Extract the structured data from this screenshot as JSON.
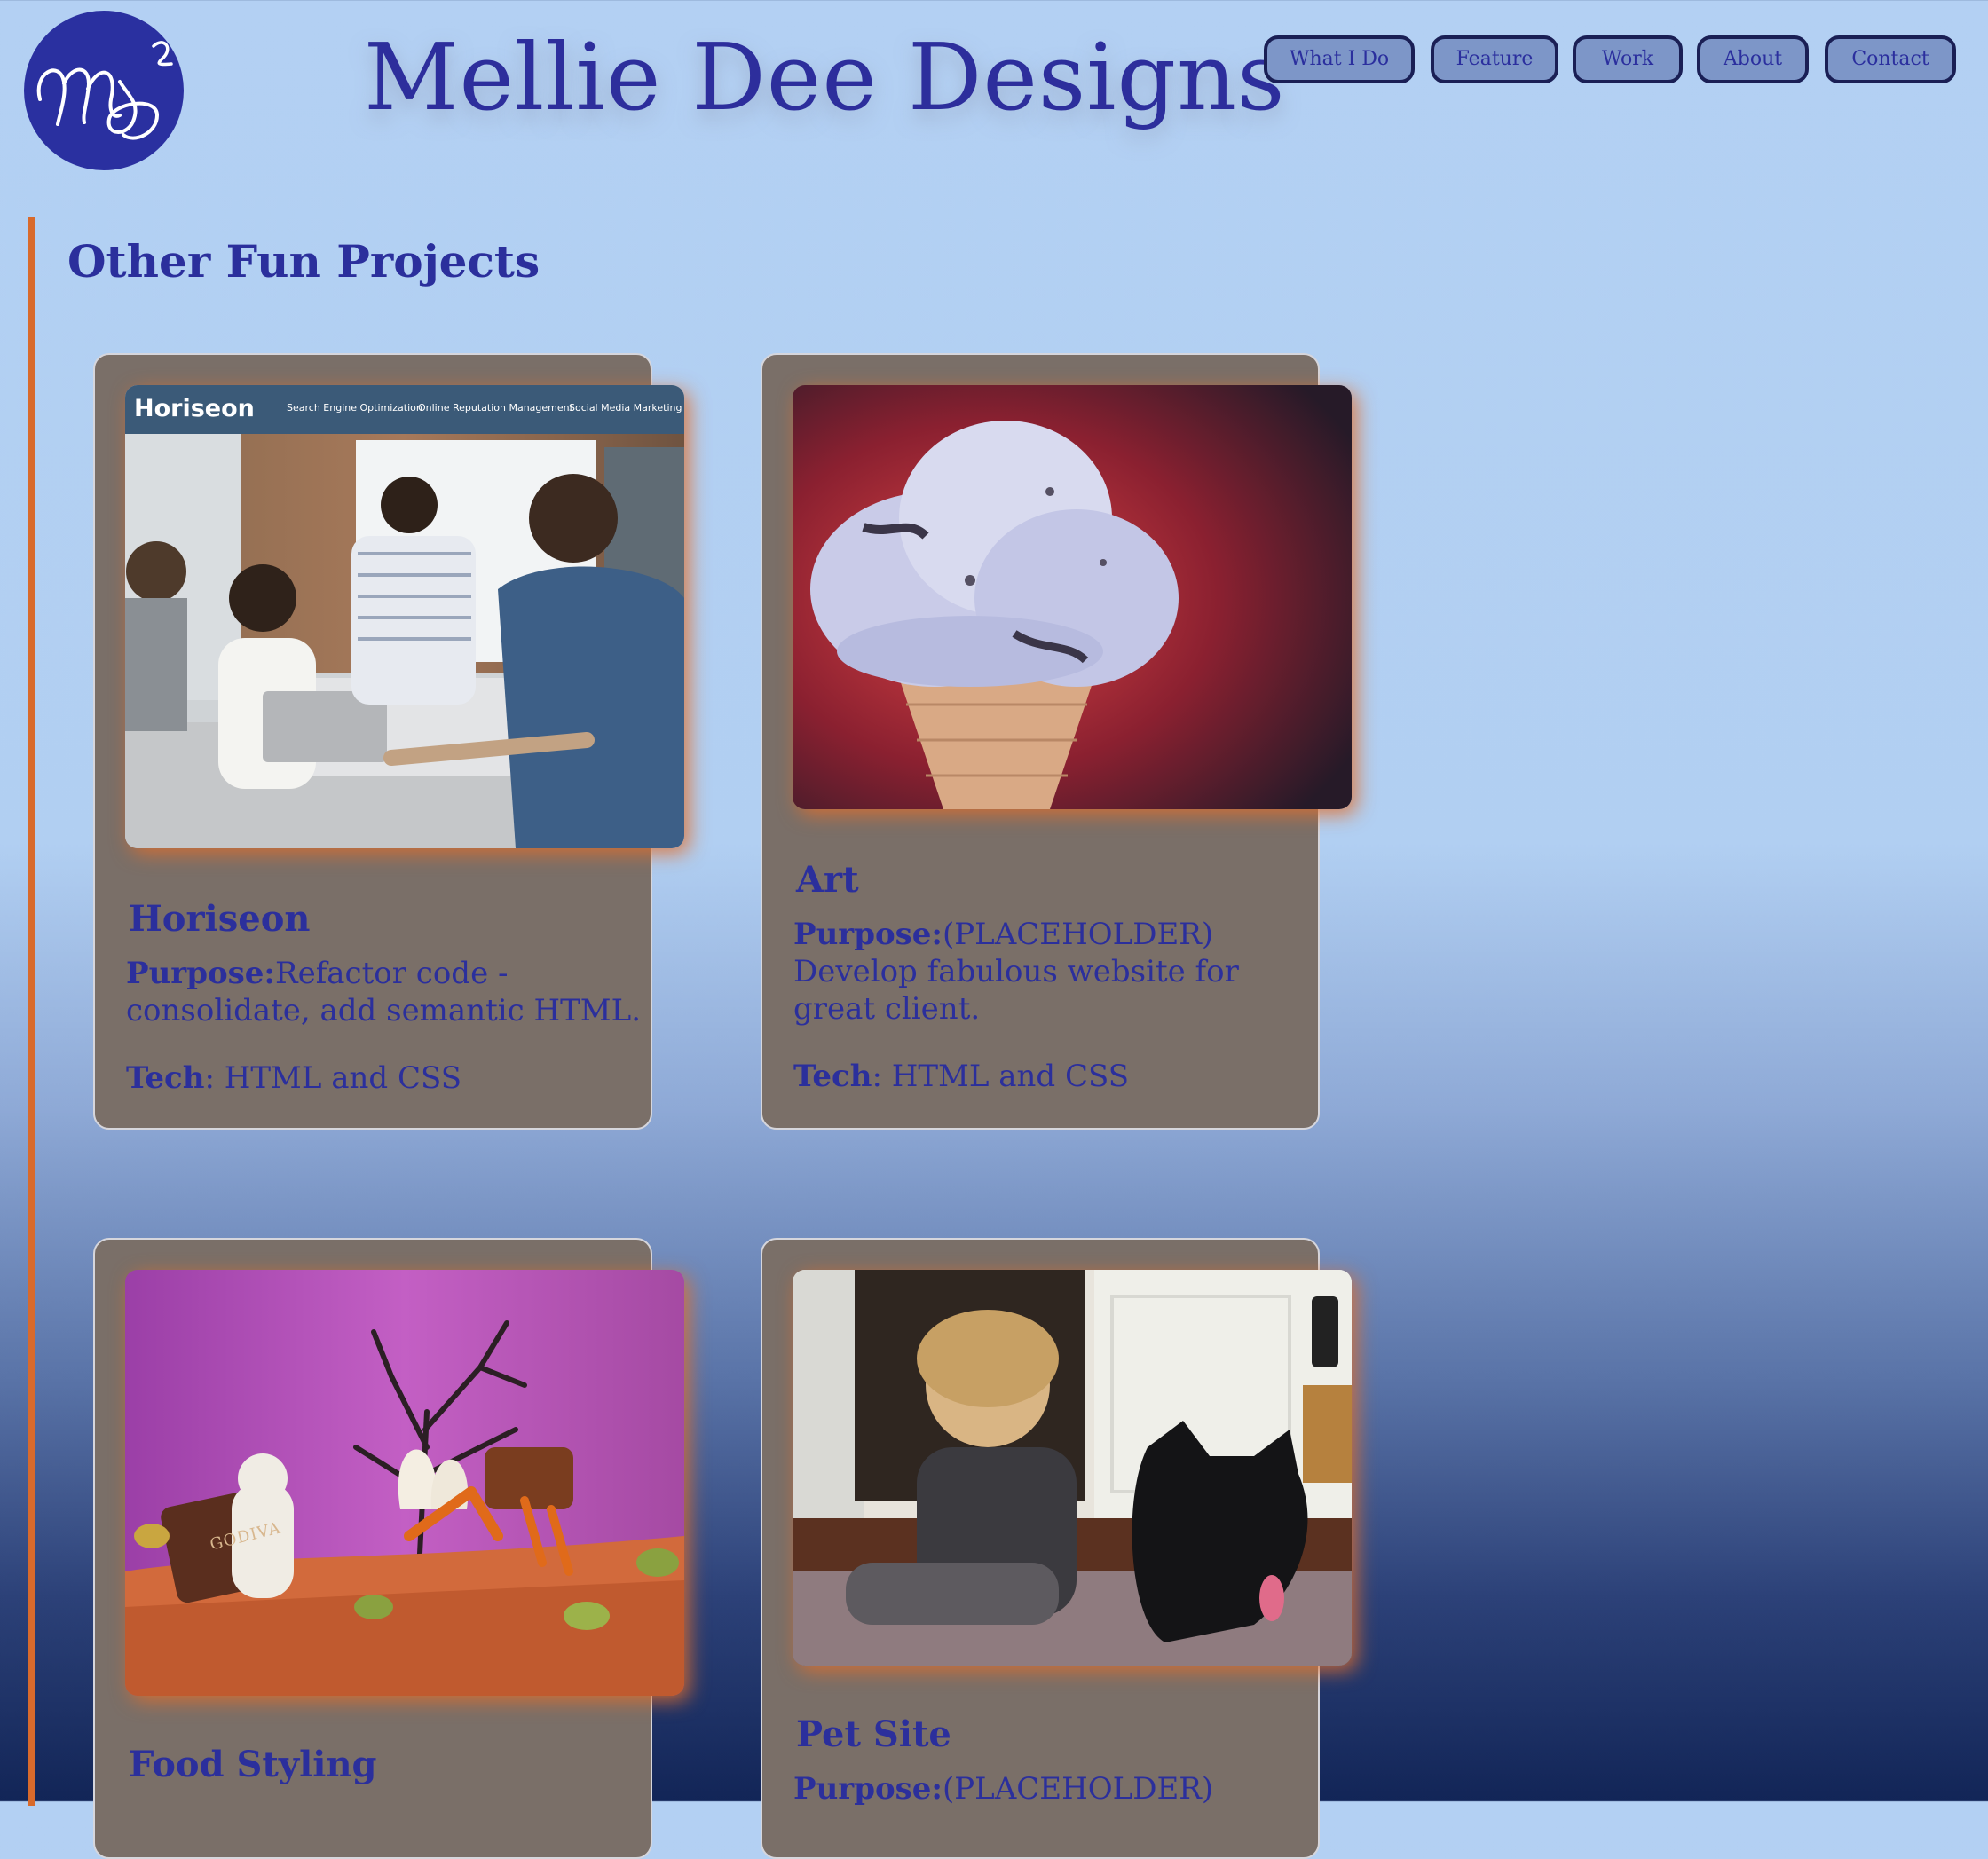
{
  "header": {
    "site_title": "Mellie Dee Designs"
  },
  "nav": {
    "items": [
      {
        "label": "What I Do"
      },
      {
        "label": "Feature"
      },
      {
        "label": "Work"
      },
      {
        "label": "About"
      },
      {
        "label": "Contact"
      }
    ]
  },
  "section": {
    "title": "Other Fun Projects"
  },
  "labels": {
    "purpose": "Purpose:",
    "tech": "Tech"
  },
  "cards": [
    {
      "title": "Horiseon",
      "purpose": "Refactor code - consolidate, add semantic HTML.",
      "tech": ": HTML and CSS",
      "image": {
        "brand": "Horiseon",
        "nav": [
          "Search Engine Optimization",
          "Online Reputation Management",
          "Social Media Marketing"
        ]
      }
    },
    {
      "title": "Art",
      "purpose": "(PLACEHOLDER) Develop fabulous website for great client.",
      "tech": ": HTML and CSS"
    },
    {
      "title": "Food Styling",
      "image": {
        "stamp": "GODIVA"
      }
    },
    {
      "title": "Pet Site",
      "purpose": "(PLACEHOLDER)"
    }
  ],
  "colors": {
    "accent_text": "#2b2f9c",
    "card_bg": "#7a6f68",
    "section_bar": "#d86a2c",
    "logo_bg": "#2a30a0",
    "nav_bg": "#7d96c8",
    "nav_border": "#1a1f55"
  }
}
